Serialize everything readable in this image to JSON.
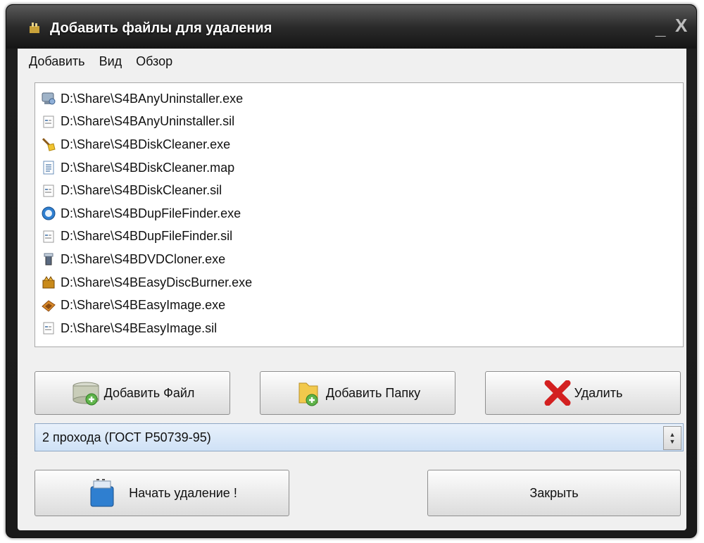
{
  "window": {
    "title": "Добавить файлы для удаления",
    "minimize_glyph": "_",
    "close_glyph": "X"
  },
  "menu": [
    "Добавить",
    "Вид",
    "Обзор"
  ],
  "files": [
    {
      "path": "D:\\Share\\S4BAnyUninstaller.exe",
      "icon": "uninstaller-exe-icon"
    },
    {
      "path": "D:\\Share\\S4BAnyUninstaller.sil",
      "icon": "sil-file-icon"
    },
    {
      "path": "D:\\Share\\S4BDiskCleaner.exe",
      "icon": "broom-exe-icon"
    },
    {
      "path": "D:\\Share\\S4BDiskCleaner.map",
      "icon": "text-file-icon"
    },
    {
      "path": "D:\\Share\\S4BDiskCleaner.sil",
      "icon": "sil-file-icon"
    },
    {
      "path": "D:\\Share\\S4BDupFileFinder.exe",
      "icon": "globe-exe-icon"
    },
    {
      "path": "D:\\Share\\S4BDupFileFinder.sil",
      "icon": "sil-file-icon"
    },
    {
      "path": "D:\\Share\\S4BDVDCloner.exe",
      "icon": "dvd-exe-icon"
    },
    {
      "path": "D:\\Share\\S4BEasyDiscBurner.exe",
      "icon": "burner-exe-icon"
    },
    {
      "path": "D:\\Share\\S4BEasyImage.exe",
      "icon": "image-exe-icon"
    },
    {
      "path": "D:\\Share\\S4BEasyImage.sil",
      "icon": "sil-file-icon"
    }
  ],
  "buttons": {
    "add_file": "Добавить Файл",
    "add_folder": "Добавить Папку",
    "delete": "Удалить",
    "start": "Начать удаление !",
    "close": "Закрыть"
  },
  "method_select": {
    "value": "2 прохода (ГОСТ Р50739-95)"
  },
  "colors": {
    "titlebar": "#2b2b2b",
    "client": "#f0f0f0",
    "combo": "#cfe1f6",
    "delete_red": "#d32020"
  }
}
